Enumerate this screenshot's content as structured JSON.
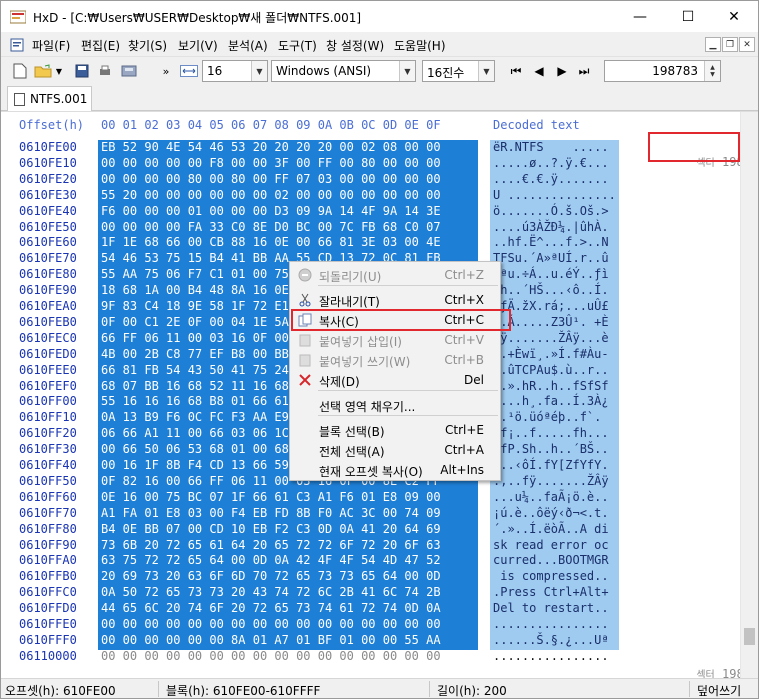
{
  "window": {
    "title": "HxD - [C:₩Users₩USER₩Desktop₩새 폴더₩NTFS.001]",
    "min": "—",
    "max": "☐",
    "close": "✕"
  },
  "menu": {
    "items": [
      "파일(F)",
      "편집(E)",
      "찾기(S)",
      "보기(V)",
      "분석(A)",
      "도구(T)",
      "창 설정(W)",
      "도움말(H)"
    ]
  },
  "toolbar": {
    "bytes_per_row": "16",
    "charset": "Windows (ANSI)",
    "offset_base": "16진수",
    "sector_value": "198783",
    "overflow": "»"
  },
  "tab": {
    "label": "NTFS.001"
  },
  "editor": {
    "offset_header": "Offset(h)",
    "column_header": "00 01 02 03 04 05 06 07 08 09 0A 0B 0C 0D 0E 0F",
    "decoded_header": "Decoded text",
    "sector_top": {
      "prefix": "섹터",
      "value": "198,783"
    },
    "sector_bottom": {
      "prefix": "섹터",
      "value": "198,784"
    },
    "rows": [
      {
        "offset": "0610FE00",
        "hex": "EB 52 90 4E 54 46 53 20 20 20 20 00 02 08 00 00",
        "text": "ëR.NTFS    ....."
      },
      {
        "offset": "0610FE10",
        "hex": "00 00 00 00 00 F8 00 00 3F 00 FF 00 80 00 00 00",
        "text": ".....ø..?.ÿ.€..."
      },
      {
        "offset": "0610FE20",
        "hex": "00 00 00 00 80 00 80 00 FF 07 03 00 00 00 00 00",
        "text": "....€.€.ÿ......."
      },
      {
        "offset": "0610FE30",
        "hex": "55 20 00 00 00 00 00 00 02 00 00 00 00 00 00 00",
        "text": "U ..............."
      },
      {
        "offset": "0610FE40",
        "hex": "F6 00 00 00 01 00 00 00 D3 09 9A 14 4F 9A 14 3E",
        "text": "ö.......Ó.š.Oš.>"
      },
      {
        "offset": "0610FE50",
        "hex": "00 00 00 00 FA 33 C0 8E D0 BC 00 7C FB 68 C0 07",
        "text": "....ú3ÀŽĐ¼.|ûhÀ."
      },
      {
        "offset": "0610FE60",
        "hex": "1F 1E 68 66 00 CB 88 16 0E 00 66 81 3E 03 00 4E",
        "text": "..hf.Ë^...f.>..N"
      },
      {
        "offset": "0610FE70",
        "hex": "54 46 53 75 15 B4 41 BB AA 55 CD 13 72 0C 81 FB",
        "text": "TFSu.´A»ªUÍ.r..û"
      },
      {
        "offset": "0610FE80",
        "hex": "55 AA 75 06 F7 C1 01 00 75 03 E9 DD 00 1E 83 EC",
        "text": "Uªu.÷Á..u.éÝ..ƒì"
      },
      {
        "offset": "0610FE90",
        "hex": "18 68 1A 00 B4 48 8A 16 0E 00 8B F4 16 1F CD 13",
        "text": ".h..´HŠ...‹ô..Í."
      },
      {
        "offset": "0610FEA0",
        "hex": "9F 83 C4 18 9E 58 1F 72 E1 3B 06 0B 00 75 DB A3",
        "text": "ŸƒÄ.žX.rá;...uÛ£"
      },
      {
        "offset": "0610FEB0",
        "hex": "0F 00 C1 2E 0F 00 04 1E 5A 33 DB B9 00 20 2B C8",
        "text": "..Á.....Z3Û¹. +È"
      },
      {
        "offset": "0610FEC0",
        "hex": "66 FF 06 11 00 03 16 0F 00 8E C2 FF 06 16 00 E8",
        "text": "fÿ.......ŽÂÿ...è"
      },
      {
        "offset": "0610FED0",
        "hex": "4B 00 2B C8 77 EF B8 00 BB CD 1A 66 23 C0 75 2D",
        "text": "K.+Èwï¸.»Í.f#Àu-"
      },
      {
        "offset": "0610FEE0",
        "hex": "66 81 FB 54 43 50 41 75 24 81 F9 02 01 72 1E 16",
        "text": "f.ûTCPAu$.ù..r.."
      },
      {
        "offset": "0610FEF0",
        "hex": "68 07 BB 16 68 52 11 16 68 09 00 66 53 66 53 66",
        "text": "h.».hR..h..fSfSf"
      },
      {
        "offset": "0610FF00",
        "hex": "55 16 16 16 68 B8 01 66 61 0E 07 CD 1A 33 C0 BF",
        "text": "U...h¸.fa..Í.3À¿"
      },
      {
        "offset": "0610FF10",
        "hex": "0A 13 B9 F6 0C FC F3 AA E9 FE 01 90 90 66 60 1E",
        "text": "..¹ö.üóªéþ..f`."
      },
      {
        "offset": "0610FF20",
        "hex": "06 66 A1 11 00 66 03 06 1C 00 1E 66 68 00 00 00",
        "text": ".f¡..f.....fh..."
      },
      {
        "offset": "0610FF30",
        "hex": "00 66 50 06 53 68 01 00 68 10 00 B4 42 8A 16 0E",
        "text": ".fP.Sh..h..´BŠ.."
      },
      {
        "offset": "0610FF40",
        "hex": "00 16 1F 8B F4 CD 13 66 59 5B 5A 66 59 66 59 1F",
        "text": "...‹ôÍ.fY[ZfYfY."
      },
      {
        "offset": "0610FF50",
        "hex": "0F 82 16 00 66 FF 06 11 00 03 16 0F 00 8E C2 FF",
        "text": ".‚..fÿ.......ŽÂÿ"
      },
      {
        "offset": "0610FF60",
        "hex": "0E 16 00 75 BC 07 1F 66 61 C3 A1 F6 01 E8 09 00",
        "text": "...u¼..faÃ¡ö.è.."
      },
      {
        "offset": "0610FF70",
        "hex": "A1 FA 01 E8 03 00 F4 EB FD 8B F0 AC 3C 00 74 09",
        "text": "¡ú.è..ôëý‹ð¬<.t."
      },
      {
        "offset": "0610FF80",
        "hex": "B4 0E BB 07 00 CD 10 EB F2 C3 0D 0A 41 20 64 69",
        "text": "´.»..Í.ëòÃ..A di"
      },
      {
        "offset": "0610FF90",
        "hex": "73 6B 20 72 65 61 64 20 65 72 72 6F 72 20 6F 63",
        "text": "sk read error oc"
      },
      {
        "offset": "0610FFA0",
        "hex": "63 75 72 72 65 64 00 0D 0A 42 4F 4F 54 4D 47 52",
        "text": "curred...BOOTMGR"
      },
      {
        "offset": "0610FFB0",
        "hex": "20 69 73 20 63 6F 6D 70 72 65 73 73 65 64 00 0D",
        "text": " is compressed.."
      },
      {
        "offset": "0610FFC0",
        "hex": "0A 50 72 65 73 73 20 43 74 72 6C 2B 41 6C 74 2B",
        "text": ".Press Ctrl+Alt+"
      },
      {
        "offset": "0610FFD0",
        "hex": "44 65 6C 20 74 6F 20 72 65 73 74 61 72 74 0D 0A",
        "text": "Del to restart.."
      },
      {
        "offset": "0610FFE0",
        "hex": "00 00 00 00 00 00 00 00 00 00 00 00 00 00 00 00",
        "text": "................"
      },
      {
        "offset": "0610FFF0",
        "hex": "00 00 00 00 00 00 8A 01 A7 01 BF 01 00 00 55 AA",
        "text": "......Š.§.¿...Uª"
      },
      {
        "offset": "06110000",
        "hex": "00 00 00 00 00 00 00 00 00 00 00 00 00 00 00 00",
        "text": "................"
      }
    ]
  },
  "context_menu": {
    "items": [
      {
        "icon": "undo-icon",
        "label": "되돌리기(U)",
        "shortcut": "Ctrl+Z",
        "disabled": true
      },
      {
        "icon": "scissors-icon",
        "label": "잘라내기(T)",
        "shortcut": "Ctrl+X",
        "disabled": false
      },
      {
        "icon": "copy-icon",
        "label": "복사(C)",
        "shortcut": "Ctrl+C",
        "disabled": false
      },
      {
        "icon": "paste-insert-icon",
        "label": "붙여넣기 삽입(I)",
        "shortcut": "Ctrl+V",
        "disabled": true
      },
      {
        "icon": "paste-write-icon",
        "label": "붙여넣기 쓰기(W)",
        "shortcut": "Ctrl+B",
        "disabled": true
      },
      {
        "icon": "delete-icon",
        "label": "삭제(D)",
        "shortcut": "Del",
        "disabled": false
      },
      {
        "icon": "",
        "label": "선택 영역 채우기...",
        "shortcut": "",
        "disabled": false
      },
      {
        "icon": "",
        "label": "블록 선택(B)",
        "shortcut": "Ctrl+E",
        "disabled": false
      },
      {
        "icon": "",
        "label": "전체 선택(A)",
        "shortcut": "Ctrl+A",
        "disabled": false
      },
      {
        "icon": "",
        "label": "현재 오프셋 복사(O)",
        "shortcut": "Alt+Ins",
        "disabled": false
      }
    ]
  },
  "status": {
    "offset": "오프셋(h): 610FE00",
    "block": "블록(h): 610FE00-610FFFF",
    "length": "길이(h): 200",
    "mode": "덮어쓰기"
  },
  "colors": {
    "selection": "#1e7fd6",
    "decoded_selection": "#9fcbf1",
    "offset_text": "#1a35b4",
    "highlight": "#e0282e"
  }
}
